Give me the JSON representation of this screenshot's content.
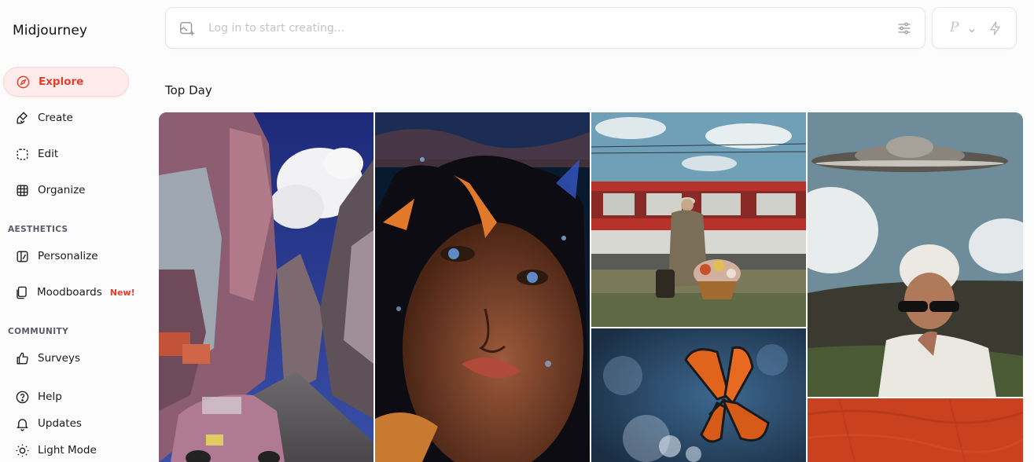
{
  "brand": "Midjourney",
  "nav": {
    "explore": "Explore",
    "create": "Create",
    "edit": "Edit",
    "organize": "Organize",
    "aesthetics_label": "AESTHETICS",
    "personalize": "Personalize",
    "moodboards": "Moodboards",
    "moodboards_badge": "New!",
    "community_label": "COMMUNITY",
    "surveys": "Surveys",
    "help": "Help",
    "updates": "Updates",
    "light_mode": "Light Mode"
  },
  "prompt": {
    "placeholder": "Log in to start creating..."
  },
  "mode": {
    "letter": "P"
  },
  "section_title": "Top Day",
  "gallery": {
    "images": [
      "city-street-image",
      "underwater-portrait-image",
      "train-traveler-image",
      "ufo-portrait-image",
      "butterfly-image",
      "orange-texture-image"
    ]
  },
  "colors": {
    "accent": "#e0402c",
    "accent_bg": "#fdeceb"
  }
}
